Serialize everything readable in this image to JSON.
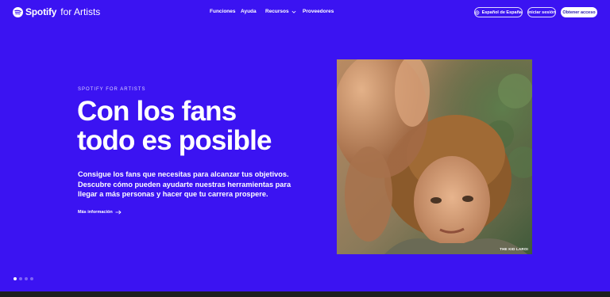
{
  "header": {
    "logo_word": "Spotify",
    "logo_sub": "for Artists",
    "nav": [
      "Funciones",
      "Ayuda",
      "Recursos",
      "Proveedores"
    ],
    "lang_label": "Español de España",
    "login_label": "Iniciar sesión",
    "access_label": "Obtener acceso"
  },
  "hero": {
    "eyebrow": "SPOTIFY FOR ARTISTS",
    "title_line1": "Con los fans",
    "title_line2": "todo es posible",
    "description": "Consigue los fans que necesitas para alcanzar tus objetivos. Descubre cómo pueden ayudarte nuestras herramientas para llegar a más personas y hacer que tu carrera prospere.",
    "more_label": "Más información",
    "image_caption": "THE KID LAROI"
  },
  "pager": {
    "count": 4,
    "active": 1
  },
  "colors": {
    "background": "#3b13f2",
    "accent_text": "#2a1cb0"
  },
  "icons": [
    "spotify-logo-icon",
    "chevron-down-icon",
    "globe-icon",
    "arrow-right-icon"
  ]
}
